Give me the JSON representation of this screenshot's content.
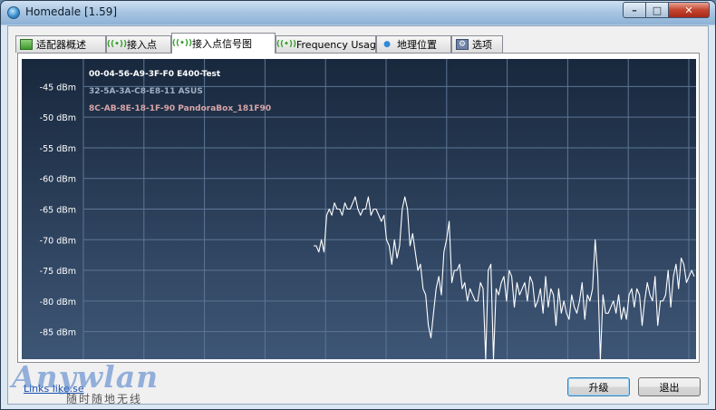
{
  "window": {
    "title": "Homedale [1.59]",
    "min_glyph": "–",
    "max_glyph": "□",
    "close_glyph": "✕"
  },
  "tabs": [
    {
      "label": "适配器概述",
      "icon": "network-card-icon"
    },
    {
      "label": "接入点",
      "icon": "access-point-icon"
    },
    {
      "label": "接入点信号图",
      "icon": "access-point-icon",
      "active": true
    },
    {
      "label": "Frequency Usage",
      "icon": "access-point-icon"
    },
    {
      "label": "地理位置",
      "icon": "map-pin-icon"
    },
    {
      "label": "选项",
      "icon": "options-icon"
    }
  ],
  "chart_data": {
    "type": "line",
    "title": "",
    "xlabel": "",
    "ylabel": "",
    "ylim": [
      -89.5,
      -40.5
    ],
    "y_ticks": [
      "-45 dBm",
      "-50 dBm",
      "-55 dBm",
      "-60 dBm",
      "-65 dBm",
      "-70 dBm",
      "-75 dBm",
      "-80 dBm",
      "-85 dBm"
    ],
    "y_tick_values": [
      -45,
      -50,
      -55,
      -60,
      -65,
      -70,
      -75,
      -80,
      -85
    ],
    "grid": true,
    "legend_position": "top-left",
    "legend": [
      {
        "name": "00-04-56-A9-3F-F0 E400-Test",
        "color": "#ffffff"
      },
      {
        "name": "32-5A-3A-C8-E8-11 ASUS",
        "color": "#9fb0c4"
      },
      {
        "name": "8C-AB-8E-18-1F-90 PandoraBox_181F90",
        "color": "#d9a5a8"
      }
    ],
    "colors": {
      "background_top": "#18283d",
      "background_bottom": "#3e5676",
      "grid": "#5d7694",
      "tick_label": "#ffffff"
    },
    "series": [
      {
        "name": "00-04-56-A9-3F-F0 E400-Test",
        "color": "#ffffff",
        "values": [
          -71,
          -71,
          -72,
          -70,
          -72,
          -66,
          -65,
          -66,
          -64,
          -65,
          -65,
          -66,
          -64,
          -65,
          -65,
          -64,
          -63,
          -65,
          -66,
          -65,
          -65,
          -63,
          -66,
          -65,
          -65,
          -66,
          -67,
          -66,
          -70,
          -71,
          -74,
          -70,
          -73,
          -71,
          -65,
          -63,
          -65,
          -71,
          -69,
          -72,
          -75,
          -74,
          -78,
          -79,
          -84,
          -86,
          -82,
          -78,
          -76,
          -79,
          -72,
          -70,
          -67,
          -77,
          -75,
          -75,
          -74,
          -78,
          -77,
          -80,
          -78,
          -79,
          -80,
          -80,
          -77,
          -78,
          -90,
          -75,
          -74,
          -94,
          -78,
          -79,
          -77,
          -76,
          -80,
          -75,
          -76,
          -81,
          -77,
          -79,
          -78,
          -77,
          -80,
          -76,
          -77,
          -81,
          -80,
          -78,
          -82,
          -76,
          -81,
          -78,
          -79,
          -84,
          -78,
          -82,
          -80,
          -82,
          -83,
          -79,
          -81,
          -82,
          -80,
          -77,
          -83,
          -79,
          -80,
          -78,
          -70,
          -76,
          -92,
          -79,
          -82,
          -82,
          -81,
          -80,
          -82,
          -79,
          -83,
          -81,
          -83,
          -79,
          -78,
          -81,
          -78,
          -79,
          -84,
          -80,
          -77,
          -79,
          -80,
          -76,
          -84,
          -80,
          -80,
          -79,
          -75,
          -81,
          -76,
          -74,
          -78,
          -73,
          -74,
          -77,
          -76,
          -75,
          -76
        ]
      }
    ]
  },
  "footer": {
    "link": "Links like.se",
    "upgrade": "升级",
    "exit": "退出"
  },
  "watermark": {
    "logo": "Anywlan",
    "sub": "随时随地无线"
  }
}
